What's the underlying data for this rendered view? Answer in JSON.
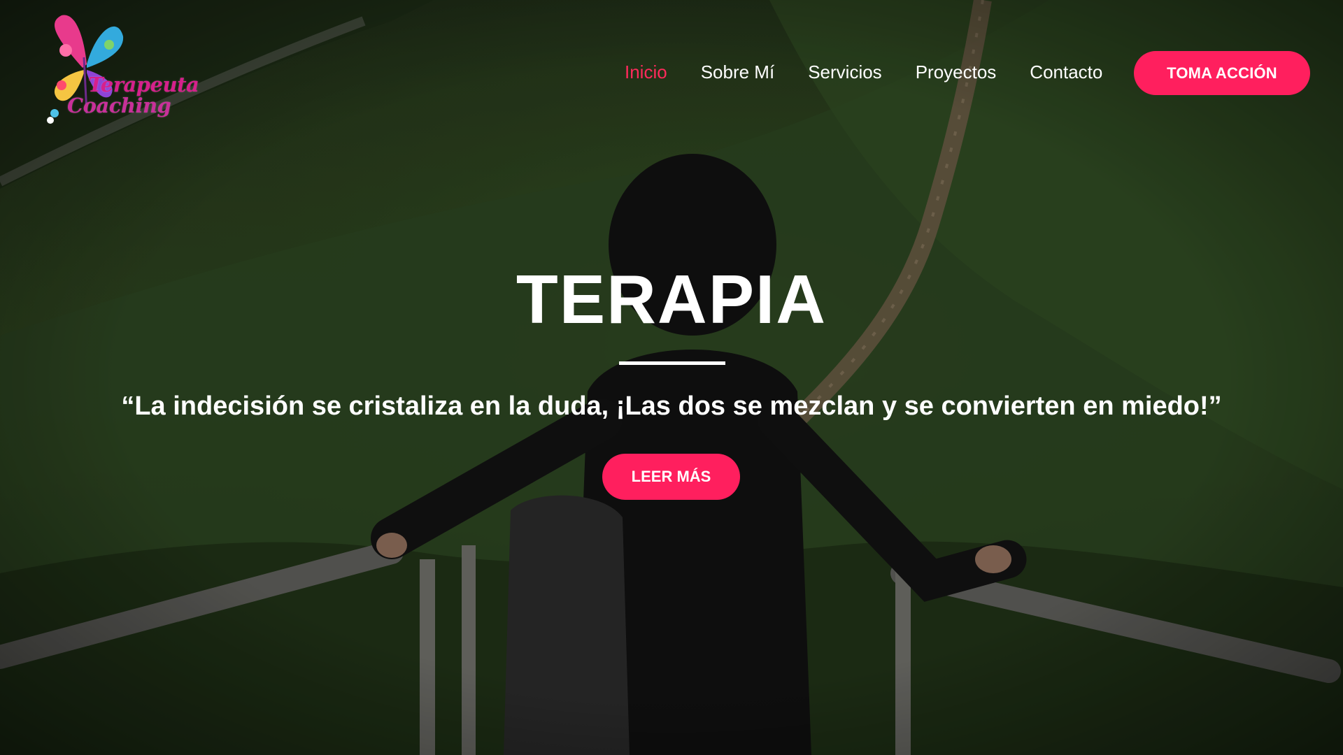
{
  "brand": {
    "line1": "Terapeuta",
    "line2": "Coaching",
    "color": "#d6208c"
  },
  "nav": {
    "items": [
      {
        "label": "Inicio",
        "active": true
      },
      {
        "label": "Sobre Mí",
        "active": false
      },
      {
        "label": "Servicios",
        "active": false
      },
      {
        "label": "Proyectos",
        "active": false
      },
      {
        "label": "Contacto",
        "active": false
      }
    ],
    "cta_label": "TOMA ACCIÓN",
    "active_color": "#ff2a5c"
  },
  "hero": {
    "title": "TERAPIA",
    "quote": "“La indecisión se cristaliza en la duda, ¡Las dos se mezclan y se convierten en miedo!”",
    "button_label": "LEER MÁS",
    "accent_color": "#ff1f5e"
  },
  "icons": {
    "logo": "butterfly-logo-icon"
  }
}
